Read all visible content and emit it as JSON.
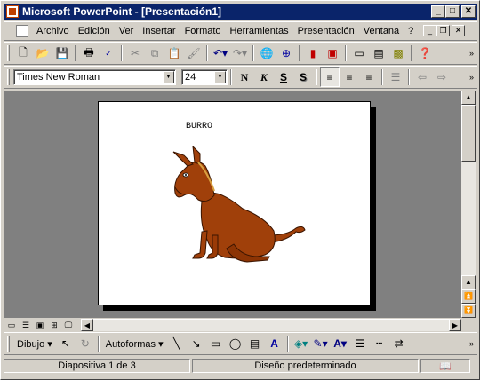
{
  "window": {
    "title": "Microsoft PowerPoint - [Presentación1]"
  },
  "menu": {
    "items": [
      "Archivo",
      "Edición",
      "Ver",
      "Insertar",
      "Formato",
      "Herramientas",
      "Presentación",
      "Ventana",
      "?"
    ]
  },
  "format_toolbar": {
    "font": "Times New Roman",
    "size": "24",
    "bold": "N",
    "italic": "K",
    "underline": "S",
    "shadow": "S"
  },
  "slide": {
    "title": "BURRO",
    "image": "donkey clipart"
  },
  "status": {
    "slide_info": "Diapositiva 1 de 3",
    "design": "Diseño predeterminado"
  },
  "drawing_toolbar": {
    "draw_label": "Dibujo",
    "autoshapes_label": "Autoformas"
  },
  "colors": {
    "titlebar": "#0a246a",
    "workspace": "#808080",
    "donkey": "#a0400a"
  }
}
